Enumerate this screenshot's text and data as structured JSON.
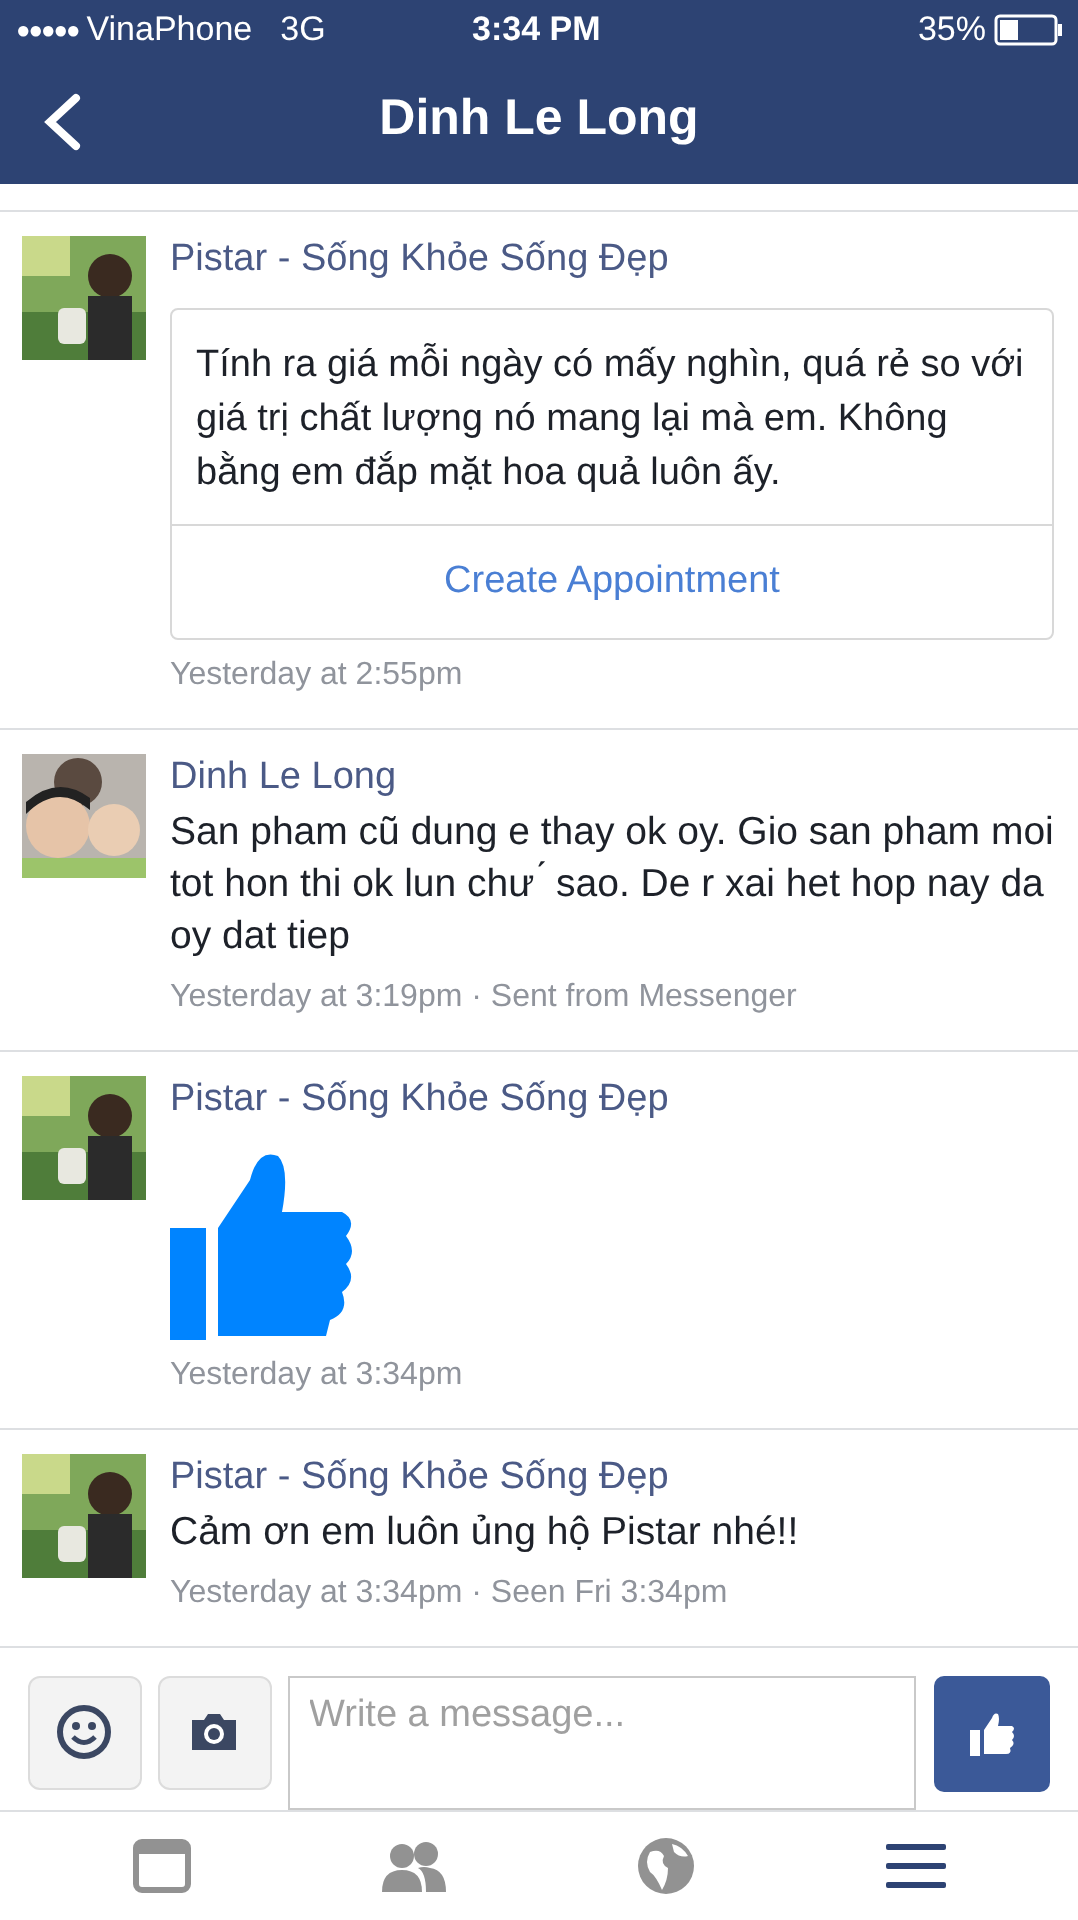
{
  "status_bar": {
    "signal_dots": "●●●●●",
    "carrier": "VinaPhone",
    "network": "3G",
    "time": "3:34 PM",
    "battery": "35%"
  },
  "header": {
    "title": "Dinh Le Long"
  },
  "messages": [
    {
      "kind": "card",
      "sender": "Pistar - Sống Khỏe Sống Đẹp",
      "text": "Tính ra giá mỗi ngày có mấy nghìn, quá rẻ so với giá trị chất lượng nó mang lại mà em. Không bằng em đắp mặt hoa quả luôn ấy.",
      "button": "Create Appointment",
      "meta": "Yesterday at 2:55pm"
    },
    {
      "kind": "text",
      "sender": "Dinh Le Long",
      "text": "San pham cũ dung e thay ok oy. Gio san pham moi tot hon thi ok lun chư ́ sao. De r xai het hop nay da oy dat tiep",
      "meta": "Yesterday at 3:19pm · Sent from Messenger"
    },
    {
      "kind": "like",
      "sender": "Pistar - Sống Khỏe Sống Đẹp",
      "meta": "Yesterday at 3:34pm"
    },
    {
      "kind": "text",
      "sender": "Pistar - Sống Khỏe Sống Đẹp",
      "text": "Cảm ơn em luôn ủng hộ Pistar nhé!!",
      "meta": "Yesterday at 3:34pm · Seen Fri 3:34pm"
    }
  ],
  "composer": {
    "placeholder": "Write a message..."
  },
  "tab_bar": [
    {
      "kind": "feed",
      "selected": false
    },
    {
      "kind": "friends",
      "selected": false
    },
    {
      "kind": "globe",
      "selected": false
    },
    {
      "kind": "menu",
      "selected": true
    }
  ]
}
